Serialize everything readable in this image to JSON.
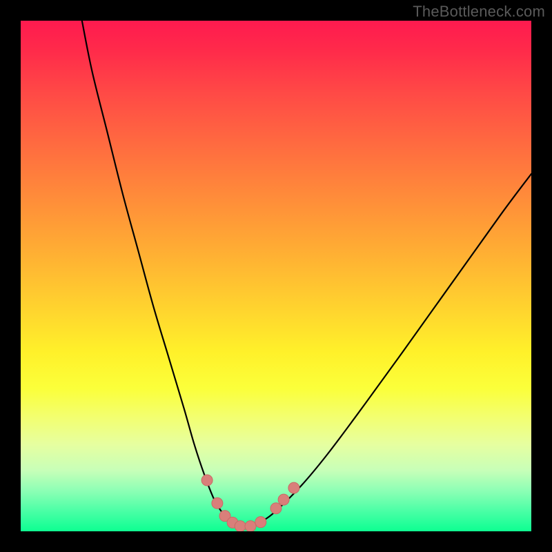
{
  "watermark": "TheBottleneck.com",
  "colors": {
    "curve": "#000000",
    "marker_fill": "#d97f7a",
    "marker_stroke": "#c96a65"
  },
  "chart_data": {
    "type": "line",
    "title": "",
    "xlabel": "",
    "ylabel": "",
    "xlim": [
      0,
      100
    ],
    "ylim": [
      0,
      100
    ],
    "grid": false,
    "legend": false,
    "background_meaning": "vertical gradient from green (low bottleneck, y≈0) to red (high bottleneck, y≈100)",
    "series": [
      {
        "name": "bottleneck-curve",
        "x": [
          12,
          14,
          17,
          20,
          23,
          26,
          29,
          32,
          34,
          36,
          38,
          40,
          41.5,
          43,
          45,
          47,
          50,
          55,
          60,
          66,
          74,
          84,
          94,
          100
        ],
        "y": [
          100,
          90,
          78,
          66,
          55,
          44,
          34,
          24,
          17,
          11,
          6,
          3,
          1.5,
          1,
          1,
          1.8,
          4,
          9,
          15,
          23,
          34,
          48,
          62,
          70
        ]
      }
    ],
    "markers": {
      "name": "curve-markers",
      "shape": "circle",
      "radius_px": 8,
      "points": [
        {
          "x": 36.5,
          "y": 10
        },
        {
          "x": 38.5,
          "y": 5.5
        },
        {
          "x": 40,
          "y": 3
        },
        {
          "x": 41.5,
          "y": 1.7
        },
        {
          "x": 43,
          "y": 1
        },
        {
          "x": 45,
          "y": 1
        },
        {
          "x": 47,
          "y": 1.8
        },
        {
          "x": 50,
          "y": 4.5
        },
        {
          "x": 51.5,
          "y": 6.2
        },
        {
          "x": 53.5,
          "y": 8.5
        }
      ]
    }
  }
}
